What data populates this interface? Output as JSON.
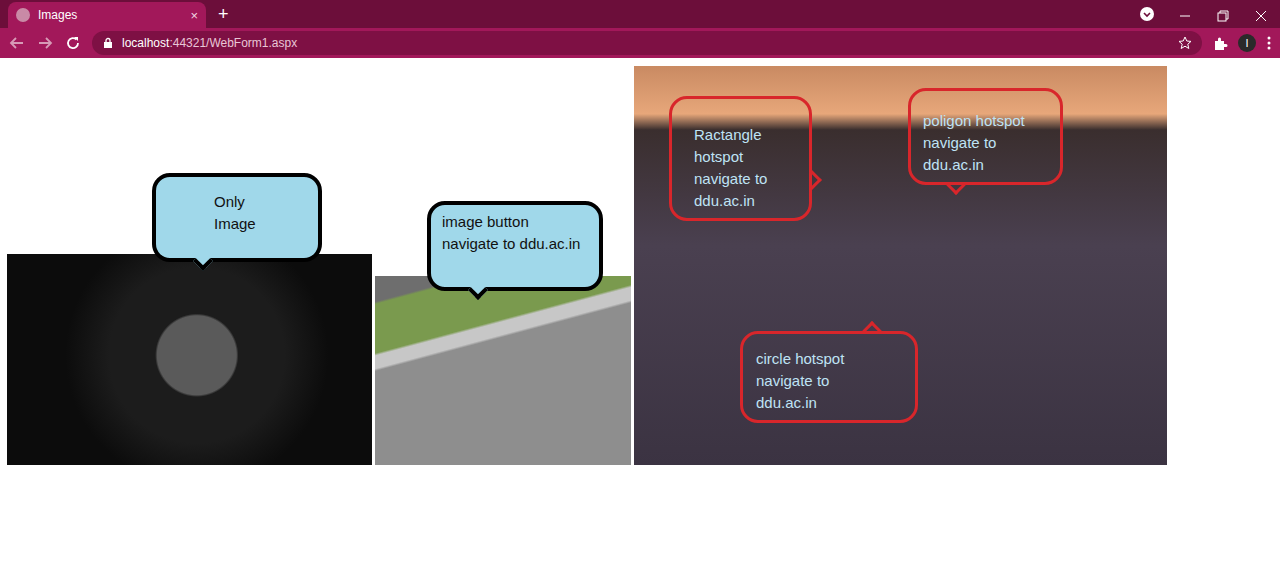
{
  "browser": {
    "tab_title": "Images",
    "tab_close": "×",
    "new_tab": "+",
    "url_host": "localhost",
    "url_rest": ":44321/WebForm1.aspx",
    "profile": "I"
  },
  "callouts": [
    {
      "kind": "filled",
      "lines": [
        "Only",
        "Image"
      ]
    },
    {
      "kind": "filled",
      "lines": [
        "image button",
        "navigate to ddu.ac.in"
      ]
    },
    {
      "kind": "outline",
      "lines": [
        "Ractangle",
        "hotspot",
        "navigate to",
        "ddu.ac.in"
      ]
    },
    {
      "kind": "outline",
      "lines": [
        "poligon hotspot",
        "navigate to",
        "ddu.ac.in"
      ]
    },
    {
      "kind": "outline",
      "lines": [
        "circle hotspot",
        "navigate to",
        "ddu.ac.in"
      ]
    }
  ]
}
